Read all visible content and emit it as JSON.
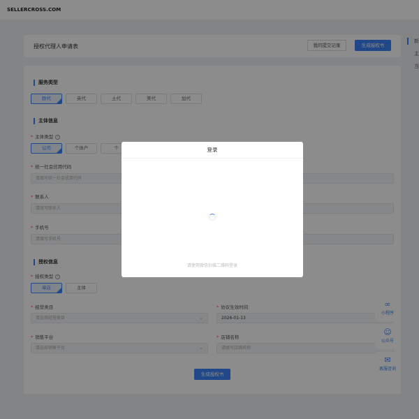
{
  "site": {
    "logo": "SELLERCROSS.COM"
  },
  "header": {
    "title": "授权代理人申请表",
    "my_records_label": "我的提交记录",
    "generate_label": "生成授权书"
  },
  "sections": {
    "service_type": {
      "title": "服务类型",
      "options": [
        "欧代",
        "英代",
        "土代",
        "美代",
        "加代"
      ]
    },
    "subject_info": {
      "title": "主体信息",
      "subject_type_label": "主体类型",
      "subject_type_options": [
        "公司",
        "个体户",
        "个"
      ],
      "credit_code_label": "统一社会信用代码",
      "credit_code_placeholder": "请填写统一社会信用代码",
      "contact_label": "联系人",
      "contact_placeholder": "请填写联系人",
      "phone_label": "手机号",
      "phone_placeholder": "请填写手机号"
    },
    "auth_info": {
      "title": "授权信息",
      "auth_type_label": "授权类型",
      "auth_type_options": [
        "单店",
        "主体"
      ],
      "category_label": "经营类目",
      "category_placeholder": "请选择经营类目",
      "effective_time_label": "协议生效时间",
      "effective_time_value": "2026-01-13",
      "platform_label": "销售平台",
      "platform_placeholder": "请选择销售平台",
      "store_label": "店铺名称",
      "store_placeholder": "请填写店铺名称"
    }
  },
  "submit_label": "生成授权书",
  "right_panel": {
    "items": [
      "新",
      "主",
      "当"
    ]
  },
  "float_buttons": [
    {
      "label": "小程序",
      "icon": "link-icon"
    },
    {
      "label": "公众号",
      "icon": "people-icon"
    },
    {
      "label": "客服咨询",
      "icon": "chat-icon"
    }
  ],
  "modal": {
    "title": "登录",
    "hint": "请使用微信扫描二维码登录"
  },
  "colors": {
    "accent": "#3b82f6",
    "overlay": "rgba(0,0,0,0.45)"
  }
}
